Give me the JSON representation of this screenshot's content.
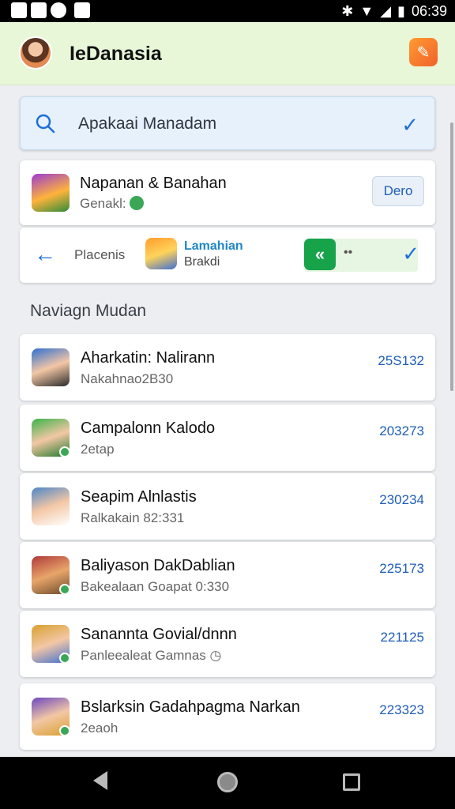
{
  "status_bar": {
    "time": "06:39",
    "icons": [
      "image-icon",
      "messenger-icon",
      "shield-icon",
      "notification-icon",
      "bluetooth-icon",
      "wifi-icon",
      "signal-icon",
      "battery-icon"
    ]
  },
  "app_bar": {
    "title": "IeDanasia",
    "avatar_icon": "profile-avatar",
    "action_icon": "share-icon",
    "bg_color": "#e9f7d9"
  },
  "search": {
    "value": "Apakaai Manadam",
    "icon": "search-icon",
    "confirm_icon": "check-icon"
  },
  "featured": {
    "title": "Napanan & Banahan",
    "subtitle": "Genakl:",
    "button_label": "Dero"
  },
  "nav_card": {
    "back_icon": "arrow-left-icon",
    "label": "Placenis",
    "item_title": "Lamahian",
    "item_subtitle": "Brakdi",
    "chip_icon": "double-chevron-left-icon",
    "chip_text": "••",
    "confirm_icon": "check-icon"
  },
  "section": {
    "title": "Naviagn Mudan"
  },
  "list": [
    {
      "title": "Aharkatin: Nalirann",
      "subtitle": "Nakahnao2B30",
      "count": "25S132",
      "color": "#2f6fd0"
    },
    {
      "title": "Campalonn Kalodo",
      "subtitle": "2etap",
      "count": "203273",
      "color": "#3bb34a"
    },
    {
      "title": "Seapim Alnlastis",
      "subtitle": "Ralkakain 82:331",
      "count": "230234",
      "color": "#4b86c8"
    },
    {
      "title": "Baliyason DakDablian",
      "subtitle": "Bakealaan Goapat 0:330",
      "count": "225173",
      "color": "#b03a3a"
    },
    {
      "title": "Sanannta Govial/dnnn",
      "subtitle": "Panleealeat Gamnas",
      "count": "221125",
      "color": "#d8a02e"
    },
    {
      "title": "Bslarksin Gadahpagma Narkan",
      "subtitle": "2eaoh",
      "count": "223323",
      "color": "#6b47c0"
    }
  ],
  "system_nav": {
    "back_icon": "nav-back-icon",
    "home_icon": "nav-home-icon",
    "recent_icon": "nav-recents-icon"
  }
}
